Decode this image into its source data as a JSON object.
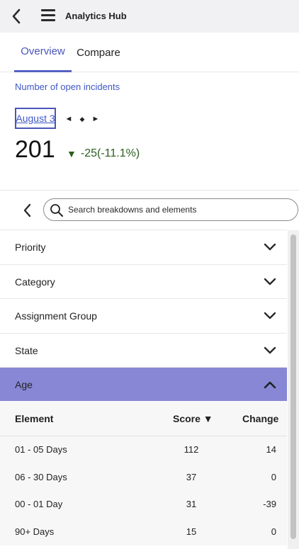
{
  "header": {
    "title": "Analytics Hub"
  },
  "tabs": [
    {
      "label": "Overview",
      "active": true
    },
    {
      "label": "Compare",
      "active": false
    }
  ],
  "metric": {
    "label": "Number of open incidents",
    "date": "August 3",
    "value": "201",
    "change": "-25",
    "change_pct": "(-11.1%)",
    "nav_prev": "◄",
    "nav_mid": "◆",
    "nav_next": "►"
  },
  "search": {
    "placeholder": "Search breakdowns and elements",
    "value": ""
  },
  "breakdowns": [
    {
      "label": "Priority",
      "expanded": false
    },
    {
      "label": "Category",
      "expanded": false
    },
    {
      "label": "Assignment Group",
      "expanded": false
    },
    {
      "label": "State",
      "expanded": false
    },
    {
      "label": "Age",
      "expanded": true
    }
  ],
  "table": {
    "columns": {
      "element": "Element",
      "score": "Score ▼",
      "change": "Change"
    },
    "rows": [
      {
        "element": "01 - 05 Days",
        "score": "112",
        "change": "14"
      },
      {
        "element": "06 - 30 Days",
        "score": "37",
        "change": "0"
      },
      {
        "element": "00 - 01 Day",
        "score": "31",
        "change": "-39"
      },
      {
        "element": "90+ Days",
        "score": "15",
        "change": "0"
      }
    ]
  },
  "colors": {
    "accent": "#4a55b8",
    "active_row": "#8787d6",
    "change_negative": "#2b5d1e",
    "header_bg": "#f1f1f4"
  }
}
